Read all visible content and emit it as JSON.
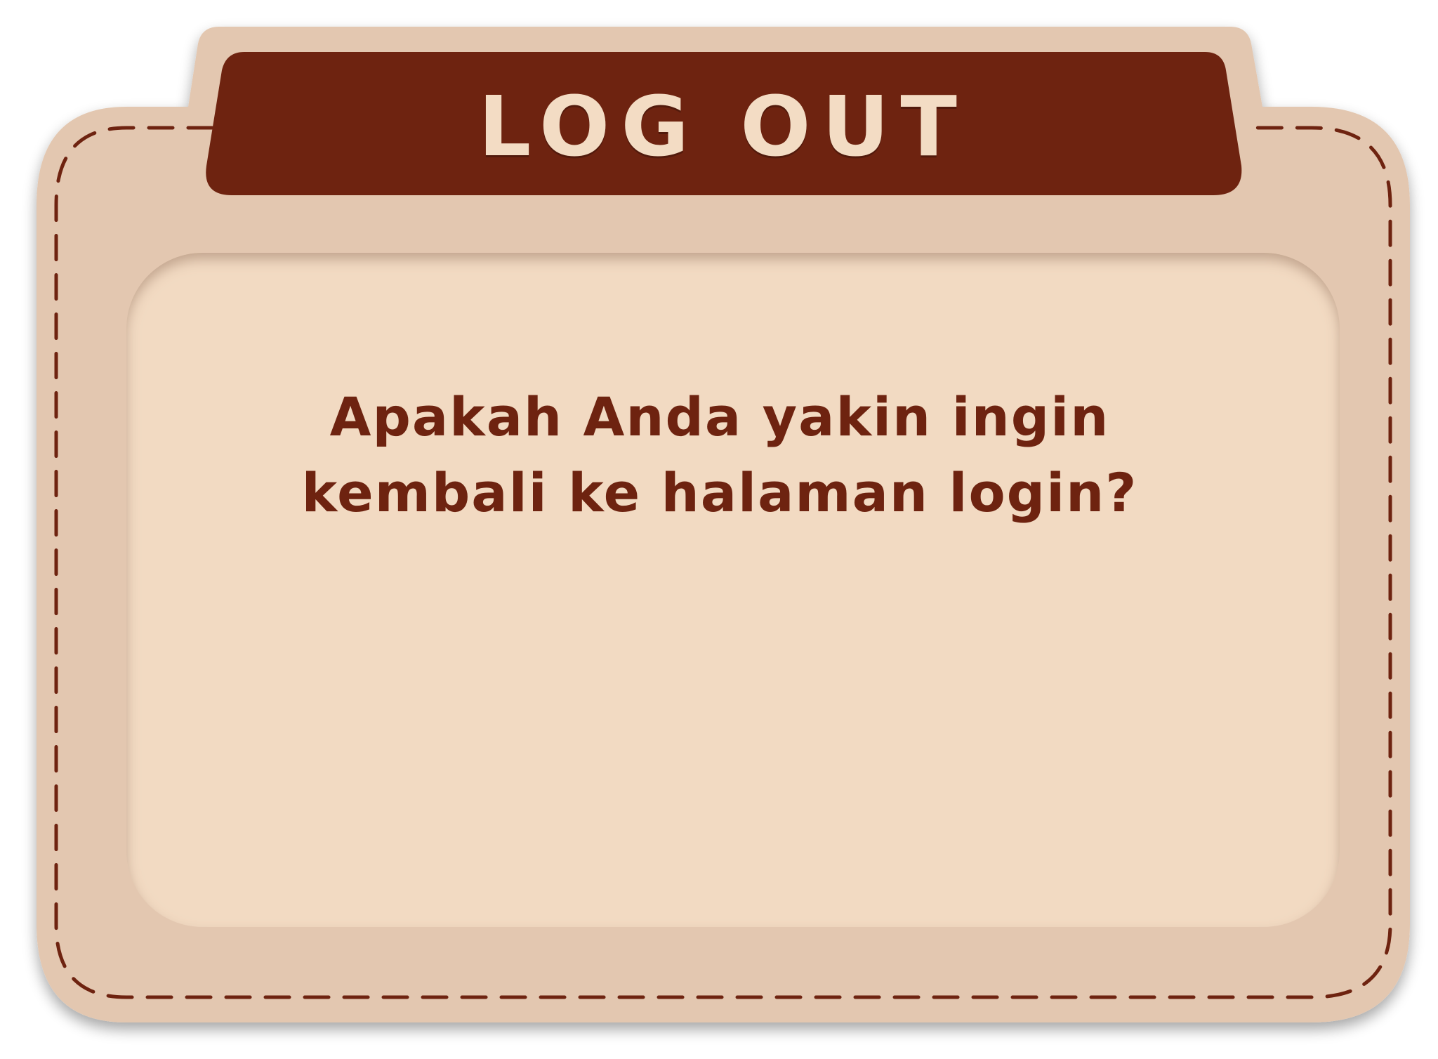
{
  "dialog": {
    "title": "LOG OUT",
    "message_line1": "Apakah Anda yakin ingin",
    "message_line2": "kembali ke halaman login?"
  },
  "colors": {
    "panel_outer": "#e3c7b0",
    "panel_inner": "#f2dac2",
    "header_bar": "#6e2310",
    "stitch": "#6e2310",
    "title_text": "#f3dcc4",
    "message_text": "#6e2310"
  }
}
